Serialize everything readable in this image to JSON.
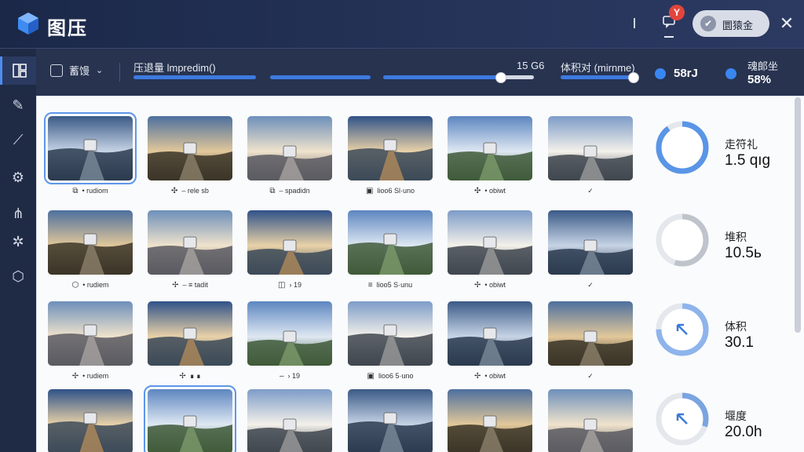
{
  "app": {
    "title": "图压",
    "user_label": "圜猿金",
    "notif_badge": "Y",
    "close_icon": "close-icon",
    "accent": "#3d7ae0"
  },
  "toolbar": {
    "format_label": "蓄馒",
    "quality_label": "压退量 lmpredim()",
    "quality_value": "15 G6",
    "quality_level": 0.78,
    "volume_label": "体积对 (mirnme)",
    "volume_level": 0.95,
    "stat_a": "58rJ",
    "stat_b_label": "魂郞坐",
    "stat_b_value": "58%"
  },
  "sidebar": {
    "items": [
      "layout-icon",
      "edit-icon",
      "brush-icon",
      "gear-icon",
      "tree-icon",
      "settings-icon",
      "shield-icon"
    ]
  },
  "grid": {
    "rows": [
      {
        "captions": [
          {
            "icon": "⧉",
            "text": "• rudiom"
          },
          {
            "icon": "✣",
            "text": "– rele sb"
          },
          {
            "icon": "⧉",
            "text": "– spadidn"
          },
          {
            "icon": "▣",
            "text": "lioo6 Sl·uno"
          },
          {
            "icon": "✣",
            "text": "• obiwt"
          },
          {
            "icon": "",
            "text": "✓"
          }
        ]
      },
      {
        "captions": [
          {
            "icon": "⬡",
            "text": "• rudiem"
          },
          {
            "icon": "✢",
            "text": "– ≡ tadit"
          },
          {
            "icon": "◫",
            "text": "› 19"
          },
          {
            "icon": "≡",
            "text": "lioo5 S·unu"
          },
          {
            "icon": "✢",
            "text": "• obiwt"
          },
          {
            "icon": "",
            "text": "✓"
          }
        ]
      },
      {
        "captions": [
          {
            "icon": "✢",
            "text": "• rudiem"
          },
          {
            "icon": "✢",
            "text": "∎ ∎"
          },
          {
            "icon": "–",
            "text": "› 19"
          },
          {
            "icon": "▣",
            "text": "lioo6 5·uno"
          },
          {
            "icon": "✢",
            "text": "• obiwt"
          },
          {
            "icon": "",
            "text": "✓"
          }
        ]
      }
    ]
  },
  "metrics": [
    {
      "label": "走符礼",
      "value": "1.5 qıg"
    },
    {
      "label": "堆积",
      "value": "10.5ь"
    },
    {
      "label": "体积",
      "value": "30.1"
    },
    {
      "label": "堰度",
      "value": "20.0h"
    }
  ]
}
